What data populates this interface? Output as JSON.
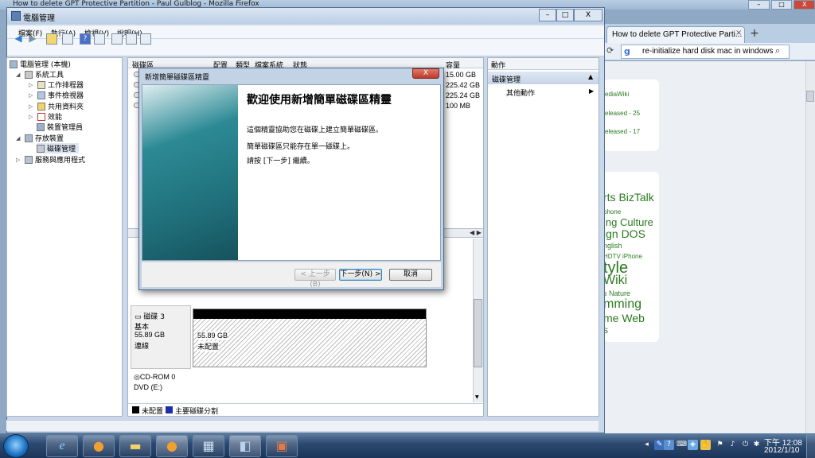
{
  "firefox": {
    "title": "How to delete GPT Protective Partition - Paul Gulblog - Mozilla Firefox",
    "controls": [
      "–",
      "□",
      "X"
    ],
    "tab_label": "How to delete GPT Protective Parti...",
    "tab_close": "×",
    "new_tab": "+",
    "search_value": "re-initialize hard disk mac in windows",
    "search_engine": "g",
    "web": {
      "card1_lines": [
        "ediaWiki",
        "eleased - 25",
        "eleased - 17"
      ],
      "tags": [
        "rts BizTalk",
        "phone",
        "ing Culture",
        "ign DOS",
        "nglish",
        "HDTV iPhone",
        "tyle",
        "Wiki",
        "s Nature",
        "mming",
        "me Web",
        "s"
      ]
    }
  },
  "window": {
    "title": "電腦管理",
    "controls": [
      "–",
      "□",
      "X"
    ],
    "menus": [
      "檔案(F)",
      "執行(A)",
      "檢視(V)",
      "說明(H)"
    ]
  },
  "tree": [
    {
      "label": "電腦管理 (本機)"
    },
    {
      "label": "系統工具"
    },
    {
      "label": "工作排程器"
    },
    {
      "label": "事件檢視器"
    },
    {
      "label": "共用資料夾"
    },
    {
      "label": "效能"
    },
    {
      "label": "裝置管理員"
    },
    {
      "label": "存放裝置"
    },
    {
      "label": "磁碟管理"
    },
    {
      "label": "服務與應用程式"
    }
  ],
  "volumes": {
    "headers": [
      "磁碟區",
      "配置",
      "類型",
      "檔案系統",
      "狀態",
      "容量"
    ],
    "capacities": [
      "15.00 GB",
      "225.42 GB",
      "225.24 GB",
      "100 MB"
    ]
  },
  "disk3": {
    "name": "磁碟 3",
    "type": "基本",
    "size": "55.89 GB",
    "status": "連線",
    "partition_size": "55.89 GB",
    "partition_status": "未配置"
  },
  "cdrom": {
    "name": "CD-ROM 0",
    "drive": "DVD (E:)"
  },
  "legend": {
    "unallocated": "未配置",
    "primary": "主要磁碟分割",
    "colors": {
      "unallocated": "#000000",
      "primary": "#1d2ea8"
    }
  },
  "actions": {
    "header": "動作",
    "section": "磁碟管理",
    "more": "其他動作"
  },
  "wizard": {
    "title": "新增簡單磁碟區精靈",
    "close": "X",
    "heading": "歡迎使用新增簡單磁碟區精靈",
    "p1": "這個精靈協助您在磁碟上建立簡單磁碟區。",
    "p2": "簡單磁碟區只能存在單一磁碟上。",
    "p3": "請按 [下一步] 繼續。",
    "back": "< 上一步(B)",
    "next": "下一步(N) >",
    "cancel": "取消"
  },
  "clock": {
    "time": "下午 12:08",
    "date": "2012/1/10"
  },
  "accent": "#2b7a1f"
}
